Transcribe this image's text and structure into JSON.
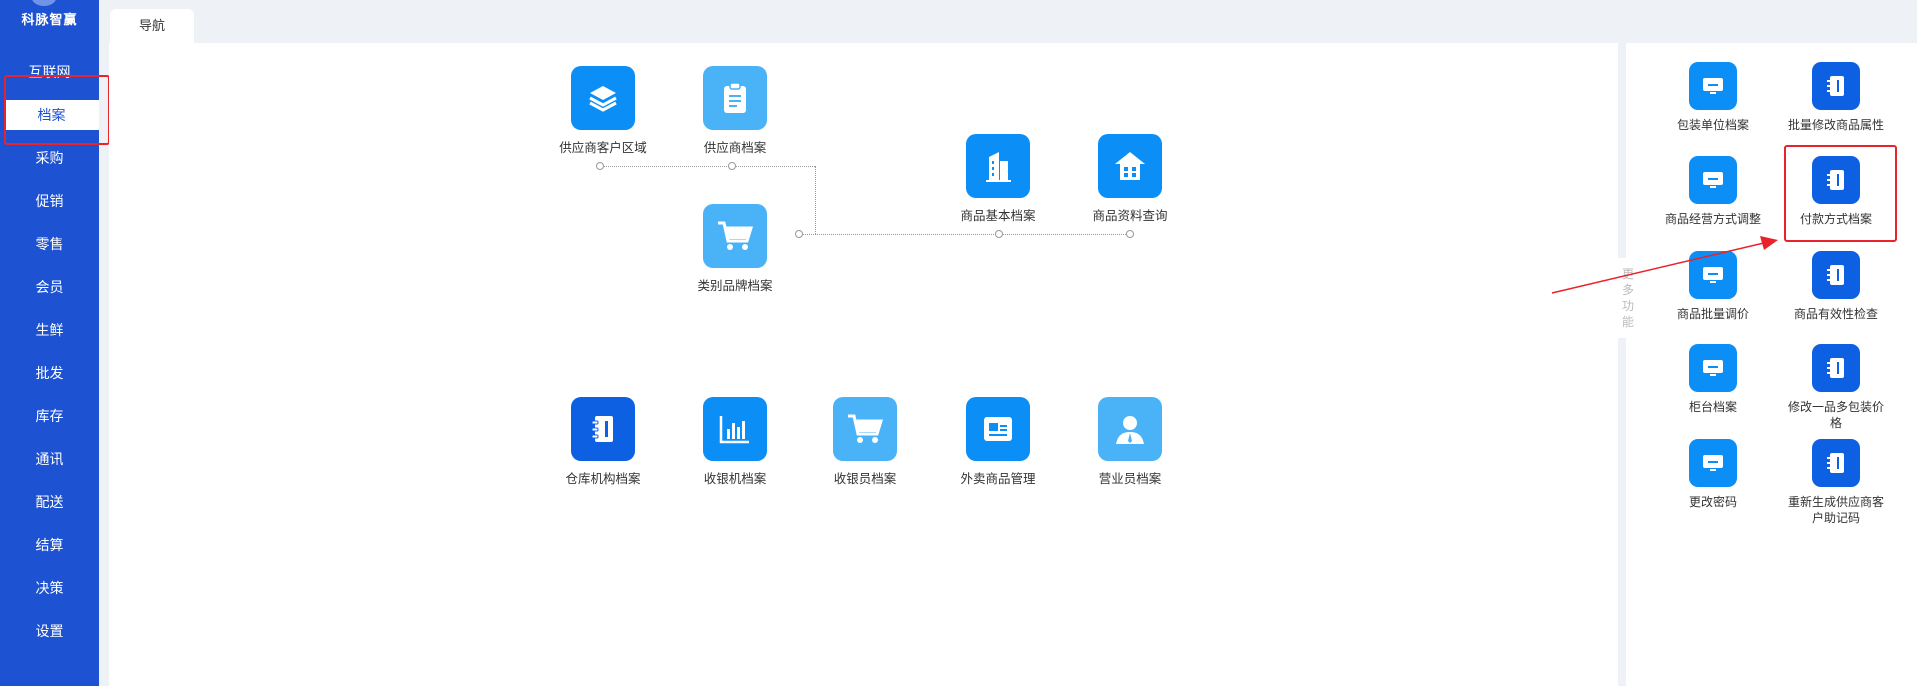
{
  "sidebar": {
    "logo_text": "科脉智赢",
    "items": [
      {
        "label": "互联网"
      },
      {
        "label": "档案"
      },
      {
        "label": "采购"
      },
      {
        "label": "促销"
      },
      {
        "label": "零售"
      },
      {
        "label": "会员"
      },
      {
        "label": "生鲜"
      },
      {
        "label": "批发"
      },
      {
        "label": "库存"
      },
      {
        "label": "通讯"
      },
      {
        "label": "配送"
      },
      {
        "label": "结算"
      },
      {
        "label": "决策"
      },
      {
        "label": "设置"
      }
    ],
    "active": "档案"
  },
  "tabs": [
    {
      "label": "导航"
    }
  ],
  "main": {
    "nodes": [
      {
        "label": "供应商客户区域",
        "icon": "layers-icon",
        "color": "#0b8ef5"
      },
      {
        "label": "供应商档案",
        "icon": "clipboard-icon",
        "color": "#4ab3f8"
      },
      {
        "label": "类别品牌档案",
        "icon": "cart-icon",
        "color": "#4ab3f8"
      },
      {
        "label": "商品基本档案",
        "icon": "building-icon",
        "color": "#0b8ef5"
      },
      {
        "label": "商品资料查询",
        "icon": "house-icon",
        "color": "#0b8ef5"
      },
      {
        "label": "仓库机构档案",
        "icon": "notebook-icon",
        "color": "#0d60e2"
      },
      {
        "label": "收银机档案",
        "icon": "bar-chart-icon",
        "color": "#0b8ef5"
      },
      {
        "label": "收银员档案",
        "icon": "cart-icon",
        "color": "#4ab3f8"
      },
      {
        "label": "外卖商品管理",
        "icon": "id-card-icon",
        "color": "#0b8ef5"
      },
      {
        "label": "营业员档案",
        "icon": "person-icon",
        "color": "#4ab3f8"
      }
    ]
  },
  "more_functions": {
    "label": "更多功能",
    "items": [
      {
        "label": "包装单位档案",
        "icon": "monitor-icon",
        "color": "#0b8ef5"
      },
      {
        "label": "批量修改商品属性",
        "icon": "notebook-icon",
        "color": "#0d60e2"
      },
      {
        "label": "商品经营方式调整",
        "icon": "monitor-icon",
        "color": "#0b8ef5"
      },
      {
        "label": "付款方式档案",
        "icon": "notebook-icon",
        "color": "#0d60e2"
      },
      {
        "label": "商品批量调价",
        "icon": "monitor-icon",
        "color": "#0b8ef5"
      },
      {
        "label": "商品有效性检查",
        "icon": "notebook-icon",
        "color": "#0d60e2"
      },
      {
        "label": "柜台档案",
        "icon": "monitor-icon",
        "color": "#0b8ef5"
      },
      {
        "label": "修改一品多包装价格",
        "icon": "notebook-icon",
        "color": "#0d60e2"
      },
      {
        "label": "更改密码",
        "icon": "monitor-icon",
        "color": "#0b8ef5"
      },
      {
        "label": "重新生成供应商客户助记码",
        "icon": "notebook-icon",
        "color": "#0d60e2"
      }
    ]
  },
  "highlight_color": "#e8232a"
}
